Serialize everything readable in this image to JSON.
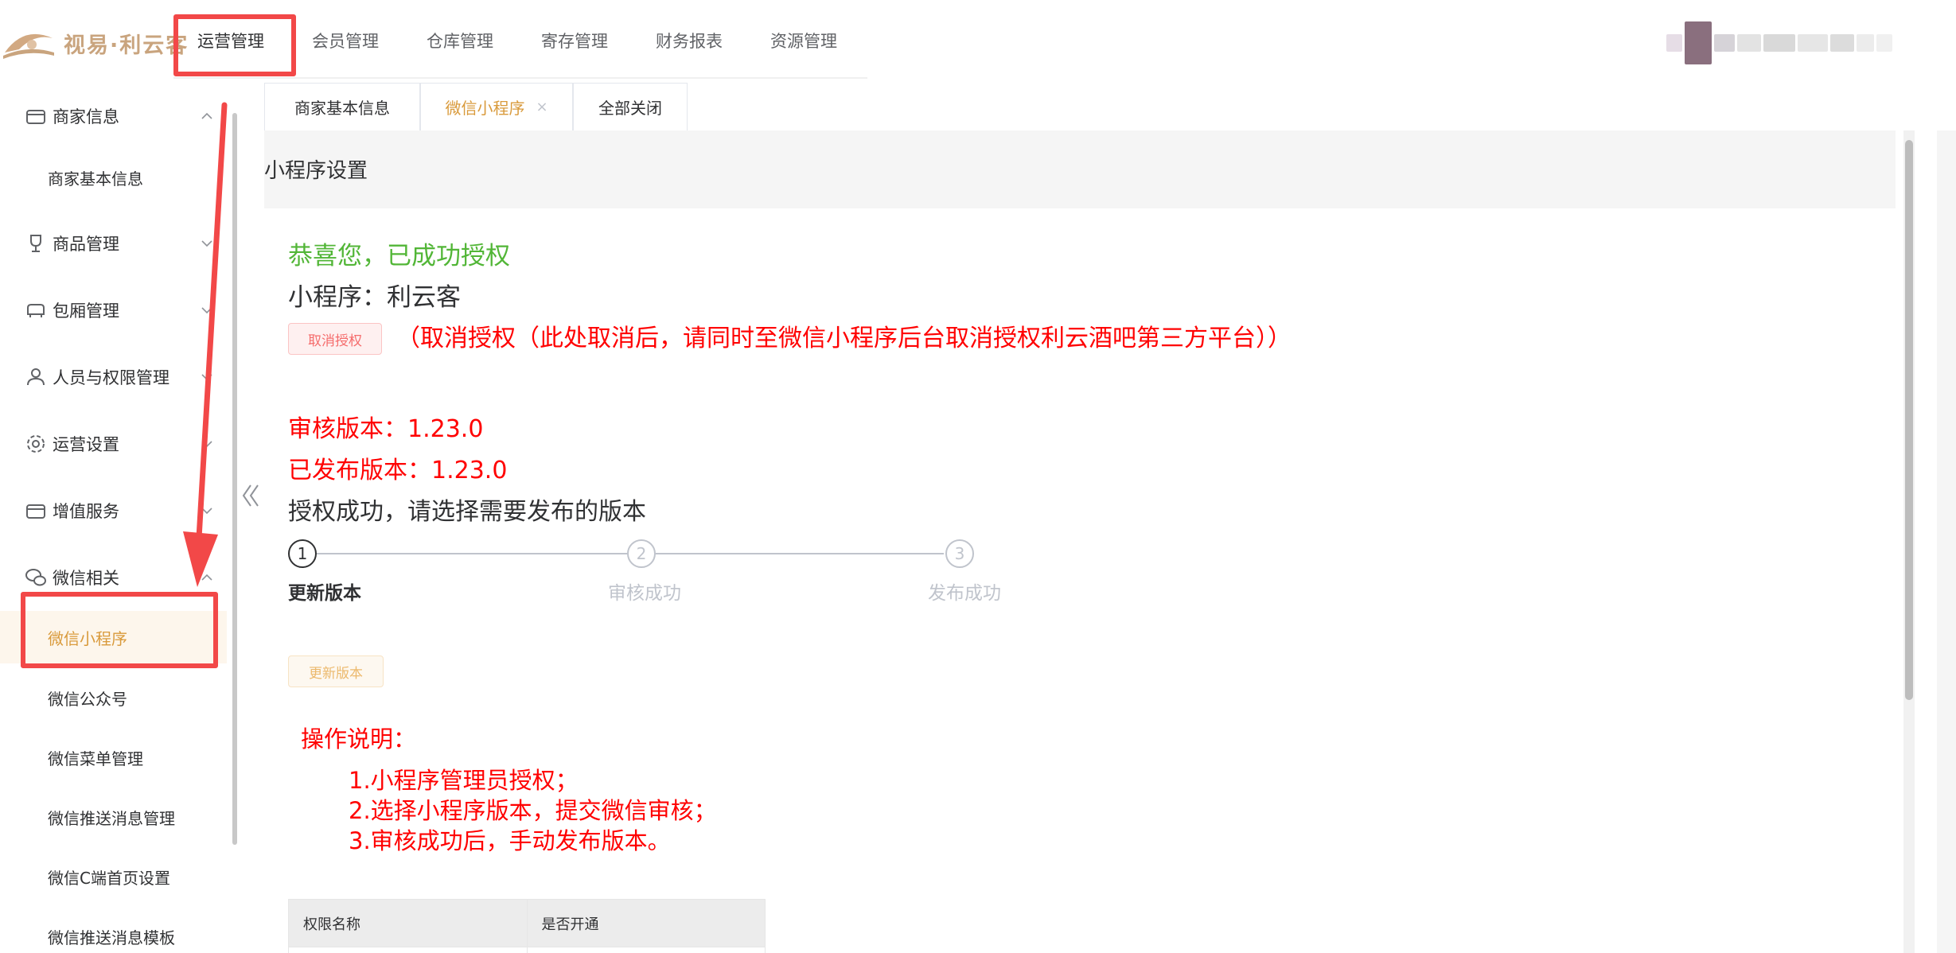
{
  "colors": {
    "accent": "#d99a3b",
    "success": "#52b637",
    "danger": "#ff0000",
    "annotation": "#f24848"
  },
  "brand": {
    "logo_text": "视易·利云客"
  },
  "top_nav": [
    "运营管理",
    "会员管理",
    "仓库管理",
    "寄存管理",
    "财务报表",
    "资源管理"
  ],
  "sidebar": {
    "groups": [
      {
        "label": "商家信息",
        "icon": "store-icon"
      },
      {
        "label": "商品管理",
        "icon": "wine-glass-icon"
      },
      {
        "label": "包厢管理",
        "icon": "sofa-icon"
      },
      {
        "label": "人员与权限管理",
        "icon": "user-icon"
      },
      {
        "label": "运营设置",
        "icon": "gear-icon"
      },
      {
        "label": "增值服务",
        "icon": "store-icon"
      },
      {
        "label": "微信相关",
        "icon": "wechat-icon"
      }
    ],
    "subs": [
      "商家基本信息",
      "微信小程序",
      "微信公众号",
      "微信菜单管理",
      "微信推送消息管理",
      "微信C端首页设置",
      "微信推送消息模板"
    ]
  },
  "tabs": {
    "items": [
      "商家基本信息",
      "微信小程序",
      "全部关闭"
    ],
    "close": "×"
  },
  "content": {
    "title": "小程序设置",
    "success": "恭喜您，已成功授权",
    "mini_name": "小程序：利云客",
    "cancel_btn": "取消授权",
    "cancel_note": "（取消授权（此处取消后，请同时至微信小程序后台取消授权利云酒吧第三方平台））",
    "audit_version": "审核版本：1.23.0",
    "published_version": "已发布版本：1.23.0",
    "choose_text": "授权成功，请选择需要发布的版本",
    "steps": [
      {
        "num": "1",
        "label": "更新版本"
      },
      {
        "num": "2",
        "label": "审核成功"
      },
      {
        "num": "3",
        "label": "发布成功"
      }
    ],
    "update_btn": "更新版本",
    "instr_title": "操作说明：",
    "instructions": [
      "1.小程序管理员授权；",
      "2.选择小程序版本，提交微信审核；",
      "3.审核成功后，手动发布版本。"
    ],
    "table_headers": [
      "权限名称",
      "是否开通"
    ]
  }
}
